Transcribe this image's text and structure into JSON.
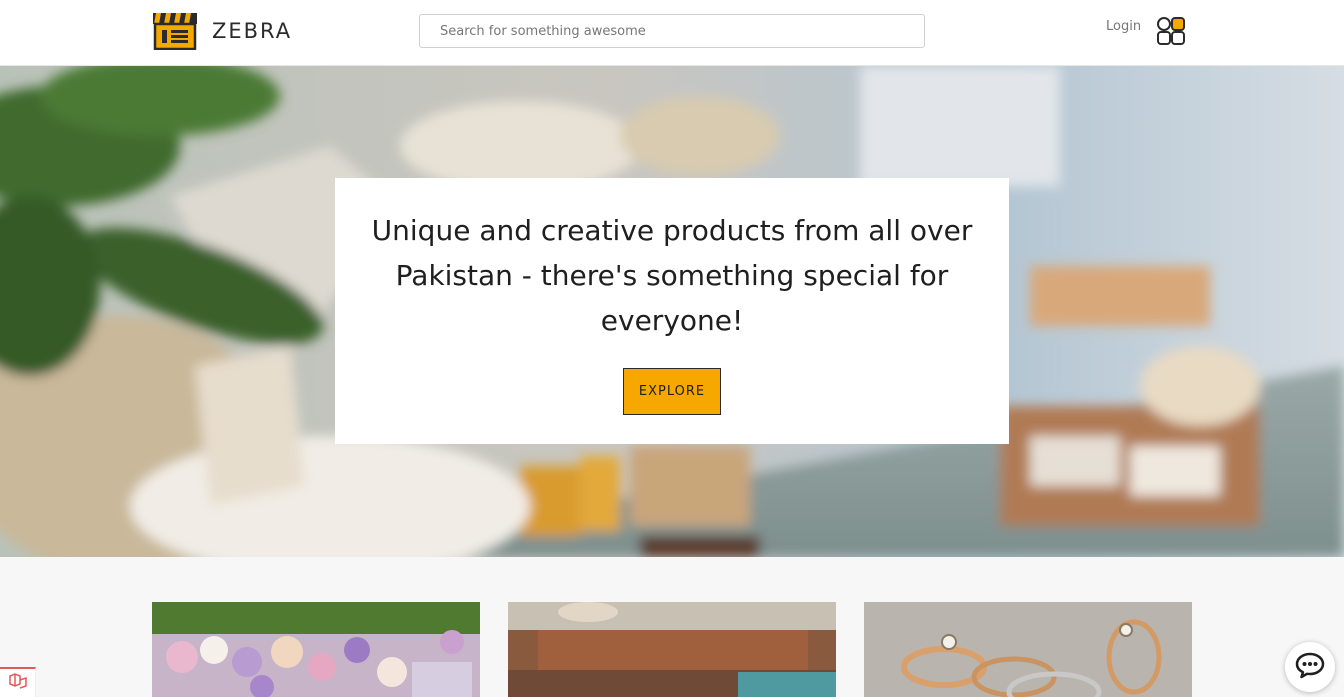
{
  "header": {
    "brand_name": "ZEBRA",
    "search_placeholder": "Search for something awesome",
    "login_label": "Login",
    "icons": {
      "logo": "storefront-logo-icon",
      "apps": "apps-grid-icon"
    }
  },
  "hero": {
    "title": "Unique and creative products from all over Pakistan - there's something special for everyone!",
    "cta_label": "EXPLORE"
  },
  "products": {
    "items": [
      {
        "image": "flower-gift-box-photo"
      },
      {
        "image": "cafe-interior-photo"
      },
      {
        "image": "gold-rings-photo"
      }
    ]
  },
  "colors": {
    "accent": "#f6a800",
    "text": "#1f1f1f",
    "muted": "#777777"
  },
  "icons": {
    "chat": "chat-bubble-icon",
    "corner": "app-badge-icon"
  }
}
